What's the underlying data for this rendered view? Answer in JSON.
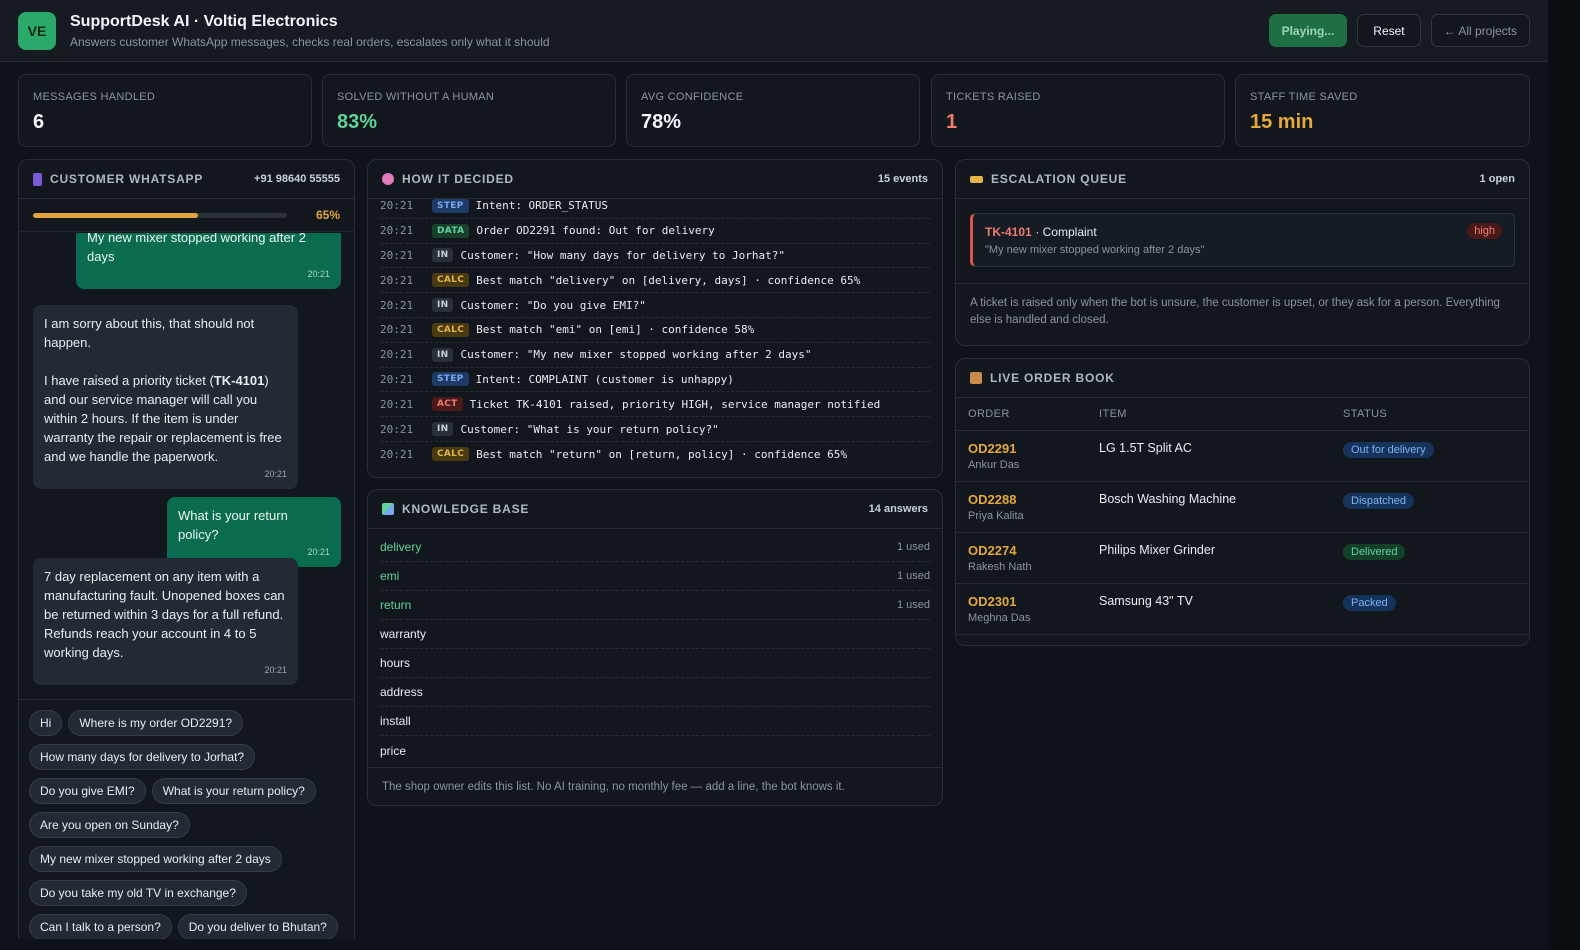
{
  "header": {
    "logo": "VE",
    "title": "SupportDesk AI · Voltiq Electronics",
    "subtitle": "Answers customer WhatsApp messages, checks real orders, escalates only what it should",
    "btn_playing": "Playing...",
    "btn_reset": "Reset",
    "btn_projects": "← All projects"
  },
  "stats": [
    {
      "label": "MESSAGES HANDLED",
      "value": "6",
      "color": "#f0f6fc"
    },
    {
      "label": "SOLVED WITHOUT A HUMAN",
      "value": "83%",
      "color": "#5fd39a"
    },
    {
      "label": "AVG CONFIDENCE",
      "value": "78%",
      "color": "#f0f6fc"
    },
    {
      "label": "TICKETS RAISED",
      "value": "1",
      "color": "#f07b6f"
    },
    {
      "label": "STAFF TIME SAVED",
      "value": "15 min",
      "color": "#e5a93a"
    }
  ],
  "chat": {
    "title": "CUSTOMER WHATSAPP",
    "phone": "+91 98640 55555",
    "progress_pct": 65,
    "progress_label": "65%",
    "messages": [
      {
        "dir": "out",
        "text": "My new mixer stopped working after 2 days",
        "time": "20:21"
      },
      {
        "dir": "in",
        "text_a": "I am sorry about this, that should not happen.",
        "text_b": "I have raised a priority ticket (",
        "ticket": "TK-4101",
        "text_c": ") and our service manager will call you within 2 hours. If the item is under warranty the repair or replacement is free and we handle the paperwork.",
        "time": "20:21"
      },
      {
        "dir": "out",
        "text": "What is your return policy?",
        "time": "20:21"
      },
      {
        "dir": "in",
        "text": "7 day replacement on any item with a manufacturing fault. Unopened boxes can be returned within 3 days for a full refund. Refunds reach your account in 4 to 5 working days.",
        "time": "20:21"
      }
    ],
    "chips": [
      "Hi",
      "Where is my order OD2291?",
      "How many days for delivery to Jorhat?",
      "Do you give EMI?",
      "What is your return policy?",
      "Are you open on Sunday?",
      "My new mixer stopped working after 2 days",
      "Do you take my old TV in exchange?",
      "Can I talk to a person?",
      "Do you deliver to Bhutan?"
    ]
  },
  "log": {
    "title": "HOW IT DECIDED",
    "meta": "15 events",
    "rows": [
      {
        "time": "20:21",
        "tag": "STEP",
        "text": "Intent: ORDER_STATUS"
      },
      {
        "time": "20:21",
        "tag": "DATA",
        "text": "Order OD2291 found: Out for delivery"
      },
      {
        "time": "20:21",
        "tag": "IN",
        "text": "Customer: \"How many days for delivery to Jorhat?\""
      },
      {
        "time": "20:21",
        "tag": "CALC",
        "text": "Best match \"delivery\" on [delivery, days] · confidence 65%"
      },
      {
        "time": "20:21",
        "tag": "IN",
        "text": "Customer: \"Do you give EMI?\""
      },
      {
        "time": "20:21",
        "tag": "CALC",
        "text": "Best match \"emi\" on [emi] · confidence 58%"
      },
      {
        "time": "20:21",
        "tag": "IN",
        "text": "Customer: \"My new mixer stopped working after 2 days\""
      },
      {
        "time": "20:21",
        "tag": "STEP",
        "text": "Intent: COMPLAINT (customer is unhappy)"
      },
      {
        "time": "20:21",
        "tag": "ACT",
        "text": "Ticket TK-4101 raised, priority HIGH, service manager notified"
      },
      {
        "time": "20:21",
        "tag": "IN",
        "text": "Customer: \"What is your return policy?\""
      },
      {
        "time": "20:21",
        "tag": "CALC",
        "text": "Best match \"return\" on [return, policy] · confidence 65%"
      }
    ]
  },
  "kb": {
    "title": "KNOWLEDGE BASE",
    "meta": "14 answers",
    "rows": [
      {
        "key": "delivery",
        "used": "1 used"
      },
      {
        "key": "emi",
        "used": "1 used"
      },
      {
        "key": "return",
        "used": "1 used"
      },
      {
        "key": "warranty",
        "used": ""
      },
      {
        "key": "hours",
        "used": ""
      },
      {
        "key": "address",
        "used": ""
      },
      {
        "key": "install",
        "used": ""
      },
      {
        "key": "price",
        "used": ""
      }
    ],
    "footer": "The shop owner edits this list. No AI training, no monthly fee — add a line, the bot knows it."
  },
  "escalation": {
    "title": "ESCALATION QUEUE",
    "meta": "1 open",
    "ticket_id": "TK-4101",
    "ticket_type": "· Complaint",
    "ticket_quote": "\"My new mixer stopped working after 2 days\"",
    "priority": "high",
    "note": "A ticket is raised only when the bot is unsure, the customer is upset, or they ask for a person. Everything else is handled and closed."
  },
  "orders": {
    "title": "LIVE ORDER BOOK",
    "columns": [
      "ORDER",
      "ITEM",
      "STATUS"
    ],
    "rows": [
      {
        "id": "OD2291",
        "customer": "Ankur Das",
        "item": "LG 1.5T Split AC",
        "status": "Out for delivery",
        "color": "blue"
      },
      {
        "id": "OD2288",
        "customer": "Priya Kalita",
        "item": "Bosch Washing Machine",
        "status": "Dispatched",
        "color": "blue"
      },
      {
        "id": "OD2274",
        "customer": "Rakesh Nath",
        "item": "Philips Mixer Grinder",
        "status": "Delivered",
        "color": "green"
      },
      {
        "id": "OD2301",
        "customer": "Meghna Das",
        "item": "Samsung 43\" TV",
        "status": "Packed",
        "color": "blue"
      }
    ]
  }
}
